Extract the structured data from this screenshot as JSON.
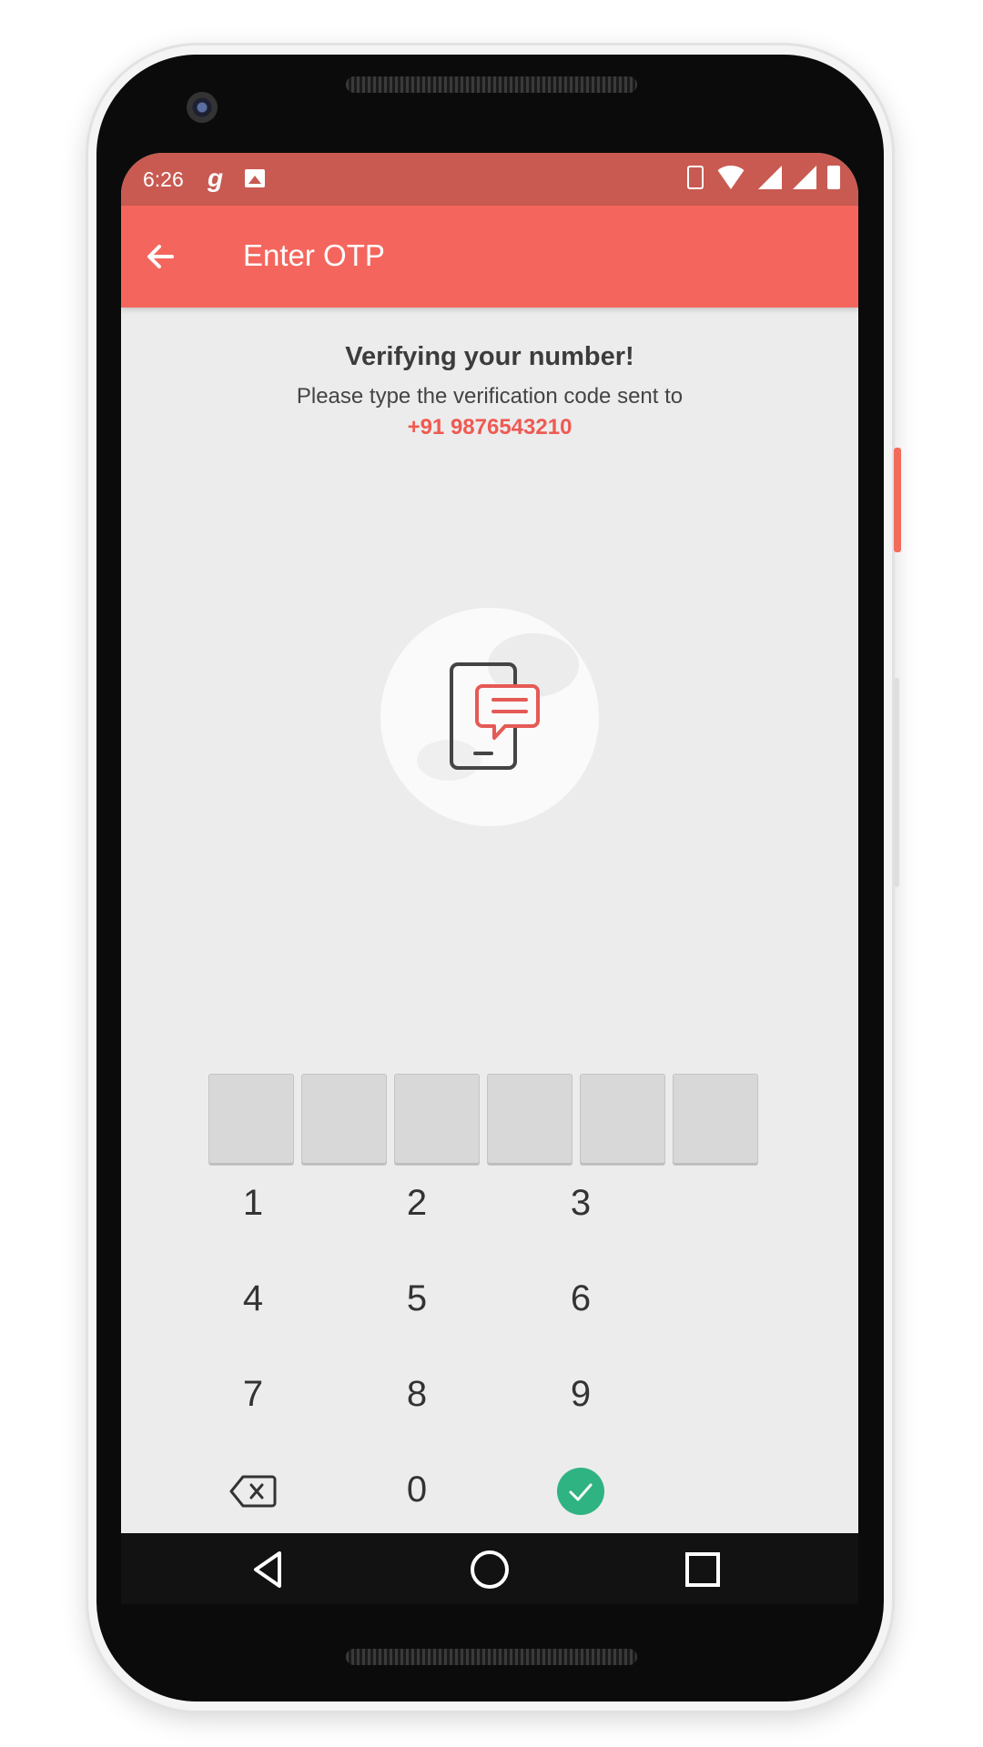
{
  "status_bar": {
    "time": "6:26",
    "app_icon_letter": "g",
    "icons": [
      "image-icon",
      "vibrate-icon",
      "wifi-icon",
      "signal-icon",
      "signal-roaming-icon",
      "battery-icon"
    ]
  },
  "app_bar": {
    "title": "Enter OTP",
    "back_icon": "arrow-left-icon",
    "color": "#f4665d"
  },
  "verify": {
    "heading": "Verifying your number!",
    "subtext": "Please type the verification code sent to",
    "phone_number": "+91 9876543210",
    "accent_color": "#ee5a52"
  },
  "otp": {
    "length": 6,
    "values": [
      "",
      "",
      "",
      "",
      "",
      ""
    ]
  },
  "keypad": {
    "keys": [
      "1",
      "2",
      "3",
      "4",
      "5",
      "6",
      "7",
      "8",
      "9",
      "",
      "0",
      ""
    ],
    "delete_icon": "backspace-icon",
    "submit_icon": "check-circle-icon",
    "submit_color": "#2fb382"
  },
  "nav_bar": {
    "buttons": [
      "back-triangle-icon",
      "home-circle-icon",
      "recents-square-icon"
    ]
  }
}
